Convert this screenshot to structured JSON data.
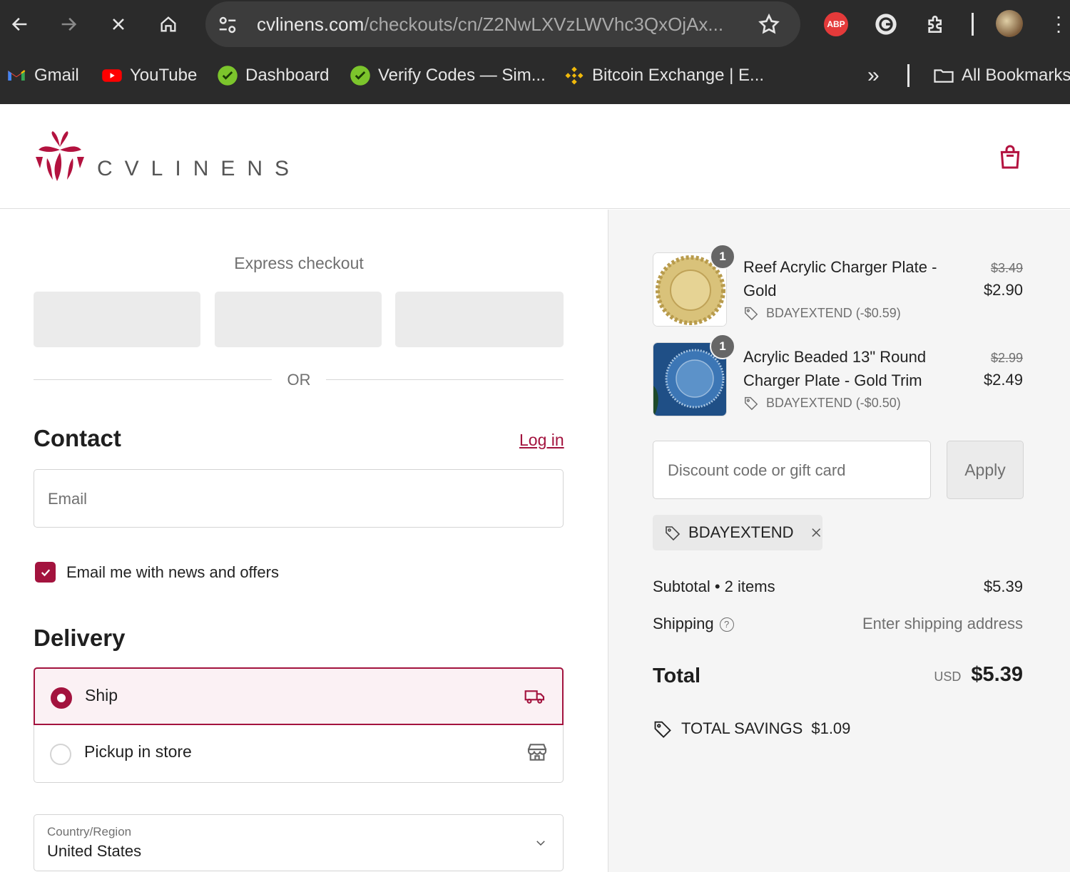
{
  "browser": {
    "url_domain": "cvlinens.com",
    "url_path": "/checkouts/cn/Z2NwLXVzLWVhc3QxOjAx...",
    "abp_label": "ABP",
    "bookmarks": [
      {
        "label": "Gmail"
      },
      {
        "label": "YouTube"
      },
      {
        "label": "Dashboard"
      },
      {
        "label": "Verify Codes — Sim..."
      },
      {
        "label": "Bitcoin Exchange | E..."
      }
    ],
    "more_label": "»",
    "all_bookmarks_label": "All Bookmarks"
  },
  "header": {
    "logo_text": "CVLINENS",
    "brand_color": "#a3133e"
  },
  "checkout": {
    "express_title": "Express checkout",
    "or_label": "OR",
    "contact_title": "Contact",
    "login_label": "Log in",
    "email_placeholder": "Email",
    "newsletter_label": "Email me with news and offers",
    "newsletter_checked": true,
    "delivery_title": "Delivery",
    "delivery_options": [
      {
        "label": "Ship",
        "selected": true,
        "icon": "truck-icon"
      },
      {
        "label": "Pickup in store",
        "selected": false,
        "icon": "store-icon"
      }
    ],
    "country_label": "Country/Region",
    "country_value": "United States"
  },
  "summary": {
    "items": [
      {
        "qty": "1",
        "name": "Reef Acrylic Charger Plate - Gold",
        "discount": "BDAYEXTEND (-$0.59)",
        "old_price": "$3.49",
        "price": "$2.90"
      },
      {
        "qty": "1",
        "name": "Acrylic Beaded 13\" Round Charger Plate - Gold Trim",
        "discount": "BDAYEXTEND (-$0.50)",
        "old_price": "$2.99",
        "price": "$2.49"
      }
    ],
    "discount_placeholder": "Discount code or gift card",
    "apply_label": "Apply",
    "applied_code": "BDAYEXTEND",
    "subtotal_label": "Subtotal • 2 items",
    "subtotal_value": "$5.39",
    "shipping_label": "Shipping",
    "shipping_value": "Enter shipping address",
    "total_label": "Total",
    "total_currency": "USD",
    "total_value": "$5.39",
    "savings_label": "TOTAL SAVINGS",
    "savings_value": "$1.09"
  }
}
